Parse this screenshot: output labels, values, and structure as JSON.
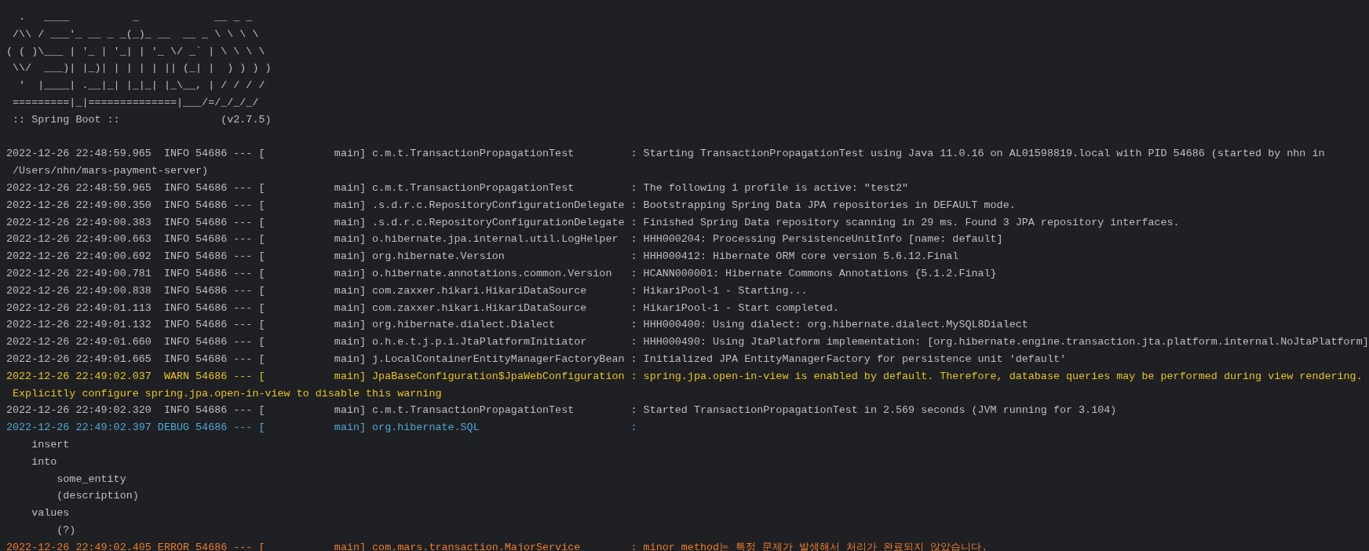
{
  "banner": [
    "  .   ____          _            __ _ _",
    " /\\\\ / ___'_ __ _ _(_)_ __  __ _ \\ \\ \\ \\",
    "( ( )\\___ | '_ | '_| | '_ \\/ _` | \\ \\ \\ \\",
    " \\\\/  ___)| |_)| | | | | || (_| |  ) ) ) )",
    "  '  |____| .__|_| |_|_| |_\\__, | / / / /",
    " =========|_|==============|___/=/_/_/_/",
    " :: Spring Boot ::                (v2.7.5)"
  ],
  "lines": [
    {
      "kind": "info",
      "text": "2022-12-26 22:48:59.965  INFO 54686 --- [           main] c.m.t.TransactionPropagationTest         : Starting TransactionPropagationTest using Java 11.0.16 on AL01598819.local with PID 54686 (started by nhn in"
    },
    {
      "kind": "info",
      "text": " /Users/nhn/mars-payment-server)"
    },
    {
      "kind": "info",
      "text": "2022-12-26 22:48:59.965  INFO 54686 --- [           main] c.m.t.TransactionPropagationTest         : The following 1 profile is active: \"test2\""
    },
    {
      "kind": "info",
      "text": "2022-12-26 22:49:00.350  INFO 54686 --- [           main] .s.d.r.c.RepositoryConfigurationDelegate : Bootstrapping Spring Data JPA repositories in DEFAULT mode."
    },
    {
      "kind": "info",
      "text": "2022-12-26 22:49:00.383  INFO 54686 --- [           main] .s.d.r.c.RepositoryConfigurationDelegate : Finished Spring Data repository scanning in 29 ms. Found 3 JPA repository interfaces."
    },
    {
      "kind": "info",
      "text": "2022-12-26 22:49:00.663  INFO 54686 --- [           main] o.hibernate.jpa.internal.util.LogHelper  : HHH000204: Processing PersistenceUnitInfo [name: default]"
    },
    {
      "kind": "info",
      "text": "2022-12-26 22:49:00.692  INFO 54686 --- [           main] org.hibernate.Version                    : HHH000412: Hibernate ORM core version 5.6.12.Final"
    },
    {
      "kind": "info",
      "text": "2022-12-26 22:49:00.781  INFO 54686 --- [           main] o.hibernate.annotations.common.Version   : HCANN000001: Hibernate Commons Annotations {5.1.2.Final}"
    },
    {
      "kind": "info",
      "text": "2022-12-26 22:49:00.838  INFO 54686 --- [           main] com.zaxxer.hikari.HikariDataSource       : HikariPool-1 - Starting..."
    },
    {
      "kind": "info",
      "text": "2022-12-26 22:49:01.113  INFO 54686 --- [           main] com.zaxxer.hikari.HikariDataSource       : HikariPool-1 - Start completed."
    },
    {
      "kind": "info",
      "text": "2022-12-26 22:49:01.132  INFO 54686 --- [           main] org.hibernate.dialect.Dialect            : HHH000400: Using dialect: org.hibernate.dialect.MySQL8Dialect"
    },
    {
      "kind": "info",
      "text": "2022-12-26 22:49:01.660  INFO 54686 --- [           main] o.h.e.t.j.p.i.JtaPlatformInitiator       : HHH000490: Using JtaPlatform implementation: [org.hibernate.engine.transaction.jta.platform.internal.NoJtaPlatform]"
    },
    {
      "kind": "info",
      "text": "2022-12-26 22:49:01.665  INFO 54686 --- [           main] j.LocalContainerEntityManagerFactoryBean : Initialized JPA EntityManagerFactory for persistence unit 'default'"
    },
    {
      "kind": "warn",
      "text": "2022-12-26 22:49:02.037  WARN 54686 --- [           main] JpaBaseConfiguration$JpaWebConfiguration : spring.jpa.open-in-view is enabled by default. Therefore, database queries may be performed during view rendering."
    },
    {
      "kind": "warn",
      "text": " Explicitly configure spring.jpa.open-in-view to disable this warning"
    },
    {
      "kind": "info",
      "text": "2022-12-26 22:49:02.320  INFO 54686 --- [           main] c.m.t.TransactionPropagationTest         : Started TransactionPropagationTest in 2.569 seconds (JVM running for 3.104)"
    },
    {
      "kind": "debug",
      "text": "2022-12-26 22:49:02.397 DEBUG 54686 --- [           main] org.hibernate.SQL                        :"
    },
    {
      "kind": "info",
      "text": "    insert"
    },
    {
      "kind": "info",
      "text": "    into"
    },
    {
      "kind": "info",
      "text": "        some_entity"
    },
    {
      "kind": "info",
      "text": "        (description)"
    },
    {
      "kind": "info",
      "text": "    values"
    },
    {
      "kind": "info",
      "text": "        (?)"
    },
    {
      "kind": "error",
      "text": "2022-12-26 22:49:02.405 ERROR 54686 --- [           main] com.mars.transaction.MajorService        : minor method는 특정 문제가 발생해서 처리가 완료되지 않았습니다."
    }
  ]
}
